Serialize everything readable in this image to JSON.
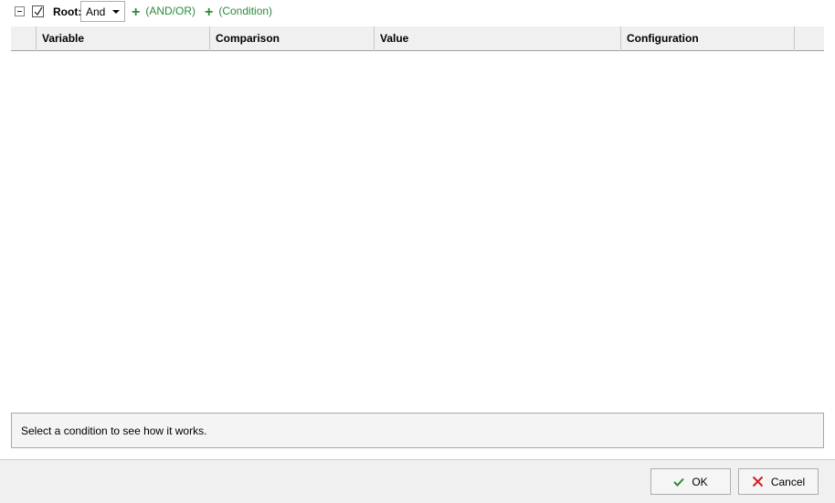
{
  "toolbar": {
    "root_label": "Root:",
    "operator_value": "And",
    "add_andor_label": "(AND/OR)",
    "add_condition_label": "(Condition)"
  },
  "grid": {
    "columns": [
      "",
      "Variable",
      "Comparison",
      "Value",
      "Configuration",
      ""
    ]
  },
  "help": {
    "text": "Select a condition to see how it works."
  },
  "footer": {
    "ok_label": "OK",
    "cancel_label": "Cancel"
  },
  "colors": {
    "accent_green": "#2a8a3a",
    "cancel_red": "#d02020"
  }
}
